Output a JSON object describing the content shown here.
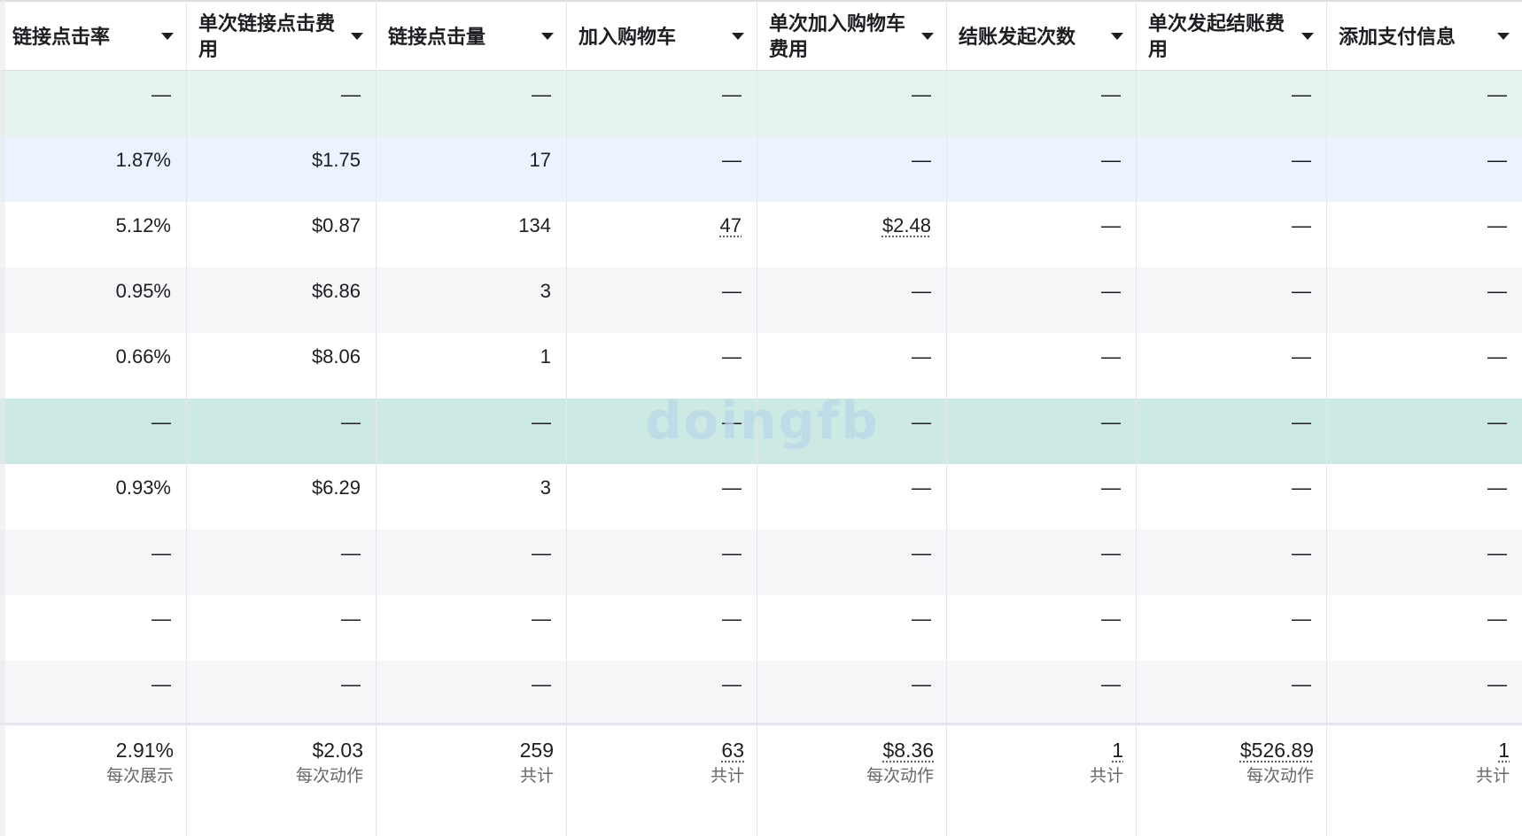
{
  "columns": [
    {
      "label": "链接点击率"
    },
    {
      "label": "单次链接点击费用"
    },
    {
      "label": "链接点击量"
    },
    {
      "label": "加入购物车"
    },
    {
      "label": "单次加入购物车费用"
    },
    {
      "label": "结账发起次数"
    },
    {
      "label": "单次发起结账费用"
    },
    {
      "label": "添加支付信息"
    }
  ],
  "rows": [
    {
      "bg": "#e6f4ee",
      "cells": [
        "—",
        "—",
        "—",
        "—",
        "—",
        "—",
        "—",
        "—"
      ]
    },
    {
      "bg": "#eaf3fe",
      "cells": [
        "1.87%",
        "$1.75",
        "17",
        "—",
        "—",
        "—",
        "—",
        "—"
      ]
    },
    {
      "bg": "#ffffff",
      "cells": [
        "5.12%",
        "$0.87",
        "134",
        "47",
        "$2.48",
        "—",
        "—",
        "—"
      ]
    },
    {
      "bg": "#f5f6f7",
      "cells": [
        "0.95%",
        "$6.86",
        "3",
        "—",
        "—",
        "—",
        "—",
        "—"
      ]
    },
    {
      "bg": "#ffffff",
      "cells": [
        "0.66%",
        "$8.06",
        "1",
        "—",
        "—",
        "—",
        "—",
        "—"
      ]
    },
    {
      "bg": "#cde9e3",
      "cells": [
        "—",
        "—",
        "—",
        "—",
        "—",
        "—",
        "—",
        "—"
      ]
    },
    {
      "bg": "#ffffff",
      "cells": [
        "0.93%",
        "$6.29",
        "3",
        "—",
        "—",
        "—",
        "—",
        "—"
      ]
    },
    {
      "bg": "#f5f6f7",
      "cells": [
        "—",
        "—",
        "—",
        "—",
        "—",
        "—",
        "—",
        "—"
      ]
    },
    {
      "bg": "#ffffff",
      "cells": [
        "—",
        "—",
        "—",
        "—",
        "—",
        "—",
        "—",
        "—"
      ]
    },
    {
      "bg": "#f5f6f7",
      "cells": [
        "—",
        "—",
        "—",
        "—",
        "—",
        "—",
        "—",
        "—"
      ]
    }
  ],
  "totals": [
    {
      "value": "2.91%",
      "sub": "每次展示"
    },
    {
      "value": "$2.03",
      "sub": "每次动作"
    },
    {
      "value": "259",
      "sub": "共计"
    },
    {
      "value": "63",
      "sub": "共计"
    },
    {
      "value": "$8.36",
      "sub": "每次动作"
    },
    {
      "value": "1",
      "sub": "共计"
    },
    {
      "value": "$526.89",
      "sub": "每次动作"
    },
    {
      "value": "1",
      "sub": "共计"
    }
  ],
  "watermark": "doingfb"
}
